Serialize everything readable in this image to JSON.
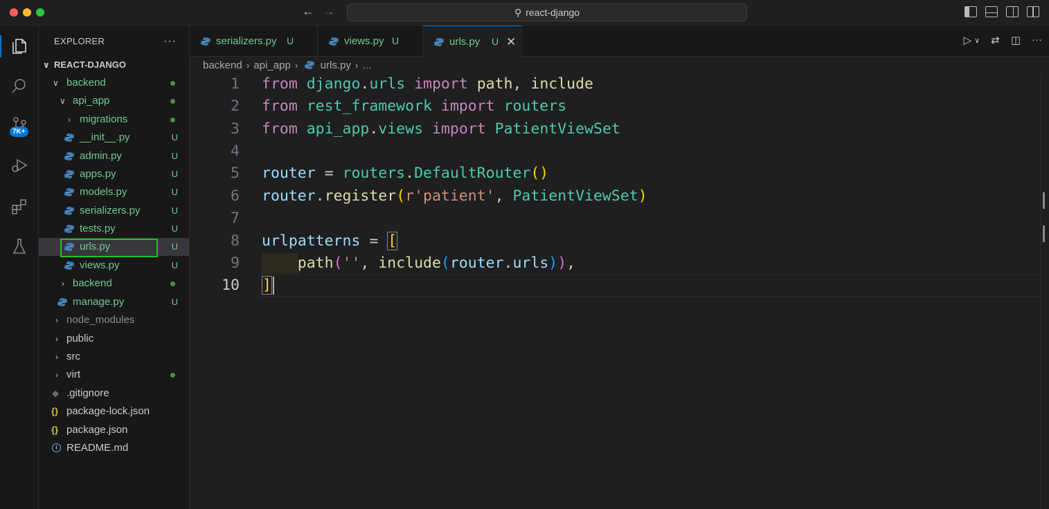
{
  "window": {
    "search_text": "react-django"
  },
  "activity": {
    "scm_badge": "7K+"
  },
  "explorer": {
    "title": "EXPLORER",
    "more": "···",
    "root": "REACT-DJANGO",
    "items": [
      {
        "label": "backend",
        "deco": "dot"
      },
      {
        "label": "api_app",
        "deco": "dot"
      },
      {
        "label": "migrations",
        "deco": "dot"
      },
      {
        "label": "__init__.py",
        "deco": "U"
      },
      {
        "label": "admin.py",
        "deco": "U"
      },
      {
        "label": "apps.py",
        "deco": "U"
      },
      {
        "label": "models.py",
        "deco": "U"
      },
      {
        "label": "serializers.py",
        "deco": "U"
      },
      {
        "label": "tests.py",
        "deco": "U"
      },
      {
        "label": "urls.py",
        "deco": "U"
      },
      {
        "label": "views.py",
        "deco": "U"
      },
      {
        "label": "backend",
        "deco": "dot"
      },
      {
        "label": "manage.py",
        "deco": "U"
      },
      {
        "label": "node_modules",
        "deco": ""
      },
      {
        "label": "public",
        "deco": ""
      },
      {
        "label": "src",
        "deco": ""
      },
      {
        "label": "virt",
        "deco": "dot"
      },
      {
        "label": ".gitignore",
        "deco": ""
      },
      {
        "label": "package-lock.json",
        "deco": ""
      },
      {
        "label": "package.json",
        "deco": ""
      },
      {
        "label": "README.md",
        "deco": ""
      }
    ]
  },
  "tabs": [
    {
      "label": "serializers.py",
      "deco": "U"
    },
    {
      "label": "views.py",
      "deco": "U"
    },
    {
      "label": "urls.py",
      "deco": "U",
      "close": "✕"
    }
  ],
  "breadcrumb": [
    "backend",
    "api_app",
    "urls.py",
    "..."
  ],
  "code": {
    "line_numbers": [
      "1",
      "2",
      "3",
      "4",
      "5",
      "6",
      "7",
      "8",
      "9",
      "10"
    ],
    "lines": [
      [
        [
          "kw",
          "from"
        ],
        [
          "p",
          " "
        ],
        [
          "mod",
          "django"
        ],
        [
          "p",
          "."
        ],
        [
          "mod",
          "urls"
        ],
        [
          "p",
          " "
        ],
        [
          "kw",
          "import"
        ],
        [
          "p",
          " "
        ],
        [
          "fn",
          "path"
        ],
        [
          "p",
          ", "
        ],
        [
          "fn",
          "include"
        ]
      ],
      [
        [
          "kw",
          "from"
        ],
        [
          "p",
          " "
        ],
        [
          "mod",
          "rest_framework"
        ],
        [
          "p",
          " "
        ],
        [
          "kw",
          "import"
        ],
        [
          "p",
          " "
        ],
        [
          "mod",
          "routers"
        ]
      ],
      [
        [
          "kw",
          "from"
        ],
        [
          "p",
          " "
        ],
        [
          "mod",
          "api_app"
        ],
        [
          "p",
          "."
        ],
        [
          "mod",
          "views"
        ],
        [
          "p",
          " "
        ],
        [
          "kw",
          "import"
        ],
        [
          "p",
          " "
        ],
        [
          "cls",
          "PatientViewSet"
        ]
      ],
      [],
      [
        [
          "var",
          "router"
        ],
        [
          "p",
          " = "
        ],
        [
          "mod",
          "routers"
        ],
        [
          "p",
          "."
        ],
        [
          "cls",
          "DefaultRouter"
        ],
        [
          "br1",
          "()"
        ]
      ],
      [
        [
          "var",
          "router"
        ],
        [
          "p",
          "."
        ],
        [
          "fn",
          "register"
        ],
        [
          "br1",
          "("
        ],
        [
          "str",
          "r'patient'"
        ],
        [
          "p",
          ", "
        ],
        [
          "cls",
          "PatientViewSet"
        ],
        [
          "br1",
          ")"
        ]
      ],
      [],
      [
        [
          "var",
          "urlpatterns"
        ],
        [
          "p",
          " = "
        ],
        [
          "br1",
          "["
        ]
      ],
      [
        [
          "p",
          "    "
        ],
        [
          "fn",
          "path"
        ],
        [
          "br2",
          "("
        ],
        [
          "str",
          "''"
        ],
        [
          "p",
          ", "
        ],
        [
          "fn",
          "include"
        ],
        [
          "br3",
          "("
        ],
        [
          "var",
          "router"
        ],
        [
          "p",
          "."
        ],
        [
          "var",
          "urls"
        ],
        [
          "br3",
          ")"
        ],
        [
          "br2",
          ")"
        ],
        [
          "p",
          ","
        ]
      ],
      [
        [
          "br1",
          "]"
        ]
      ]
    ]
  },
  "colors": {
    "accent": "#0078d4",
    "untracked": "#73c991",
    "selection_outline": "#21c321"
  }
}
